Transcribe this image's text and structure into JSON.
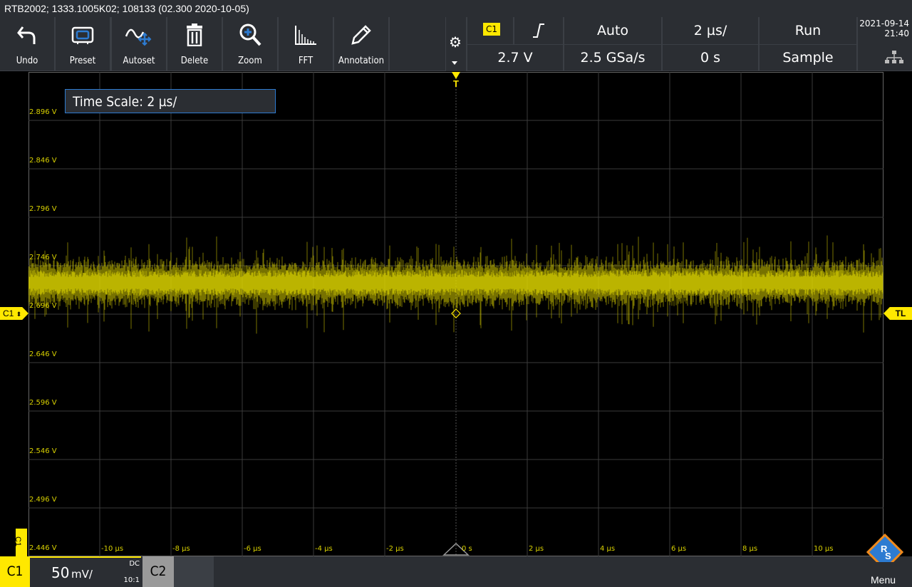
{
  "title_bar": {
    "text": "RTB2002; 1333.1005K02; 108133 (02.300 2020-10-05)"
  },
  "toolbar": {
    "buttons": [
      {
        "id": "undo",
        "label": "Undo",
        "icon": "undo-arrow-icon"
      },
      {
        "id": "preset",
        "label": "Preset",
        "icon": "preset-icon"
      },
      {
        "id": "autoset",
        "label": "Autoset",
        "icon": "autoset-icon"
      },
      {
        "id": "delete",
        "label": "Delete",
        "icon": "trash-icon"
      },
      {
        "id": "zoom",
        "label": "Zoom",
        "icon": "zoom-icon"
      },
      {
        "id": "fft",
        "label": "FFT",
        "icon": "fft-icon"
      },
      {
        "id": "annotation",
        "label": "Annotation",
        "icon": "pencil-icon"
      }
    ]
  },
  "trigger_panel": {
    "source": "C1",
    "mode": "Auto",
    "level": "2.7 V",
    "sample_rate": "2.5 GSa/s",
    "time_scale": "2 µs/",
    "position": "0 s",
    "run_state": "Run",
    "acq_mode": "Sample"
  },
  "datetime": {
    "date": "2021-09-14",
    "time": "21:40"
  },
  "tooltip": {
    "text": "Time Scale: 2 µs/"
  },
  "plot": {
    "trigger_marker": "T",
    "channel_marker": "C1",
    "trigger_level_marker": "TL",
    "y_labels": [
      "2.896 V",
      "2.846 V",
      "2.796 V",
      "2.746 V",
      "2.696 V",
      "2.646 V",
      "2.596 V",
      "2.546 V",
      "2.496 V",
      "2.446 V"
    ],
    "x_labels": [
      "-10 µs",
      "-8 µs",
      "-6 µs",
      "-4 µs",
      "-2 µs",
      "0 s",
      "2 µs",
      "4 µs",
      "6 µs",
      "8 µs",
      "10 µs"
    ],
    "trace_color": "#d8d000",
    "grid_color": "#3a3a3a"
  },
  "bottom_bar": {
    "channel": "C1",
    "scale": "50",
    "scale_unit": "mV/",
    "coupling": "DC",
    "probe": "10:1",
    "ch2": "C2",
    "menu": "Menu",
    "side_tab": "C1"
  },
  "colors": {
    "accent": "#ffe800",
    "panel": "#2b2e33",
    "blue": "#2d7bd1"
  }
}
